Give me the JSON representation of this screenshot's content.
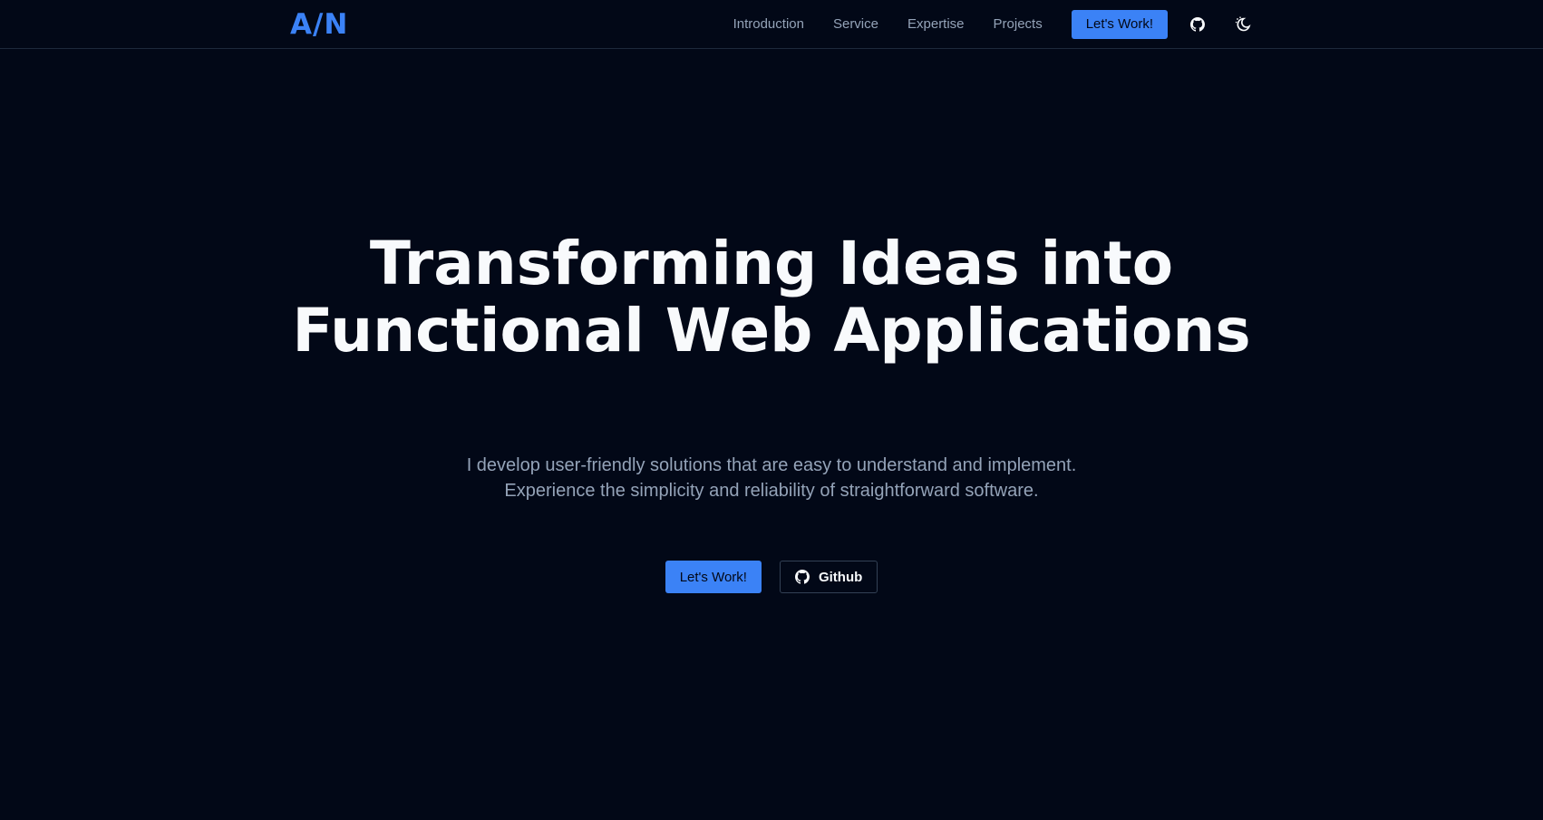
{
  "nav": {
    "logo": "A/N",
    "links": [
      "Introduction",
      "Service",
      "Expertise",
      "Projects"
    ],
    "cta_label": "Let's Work!",
    "icons": [
      "github-icon",
      "theme-toggle-icon"
    ]
  },
  "hero": {
    "title_line1": "Transforming Ideas into",
    "title_line2": "Functional Web Applications",
    "subtitle_line1": "I develop user-friendly solutions that are easy to understand and implement.",
    "subtitle_line2": "Experience the simplicity and reliability of straightforward software.",
    "primary_button": "Let's Work!",
    "secondary_button": "Github"
  },
  "colors": {
    "background": "#020817",
    "accent": "#3b82f6",
    "text": "#f8fafc",
    "muted": "#94a3b8",
    "border": "#1e293b"
  }
}
